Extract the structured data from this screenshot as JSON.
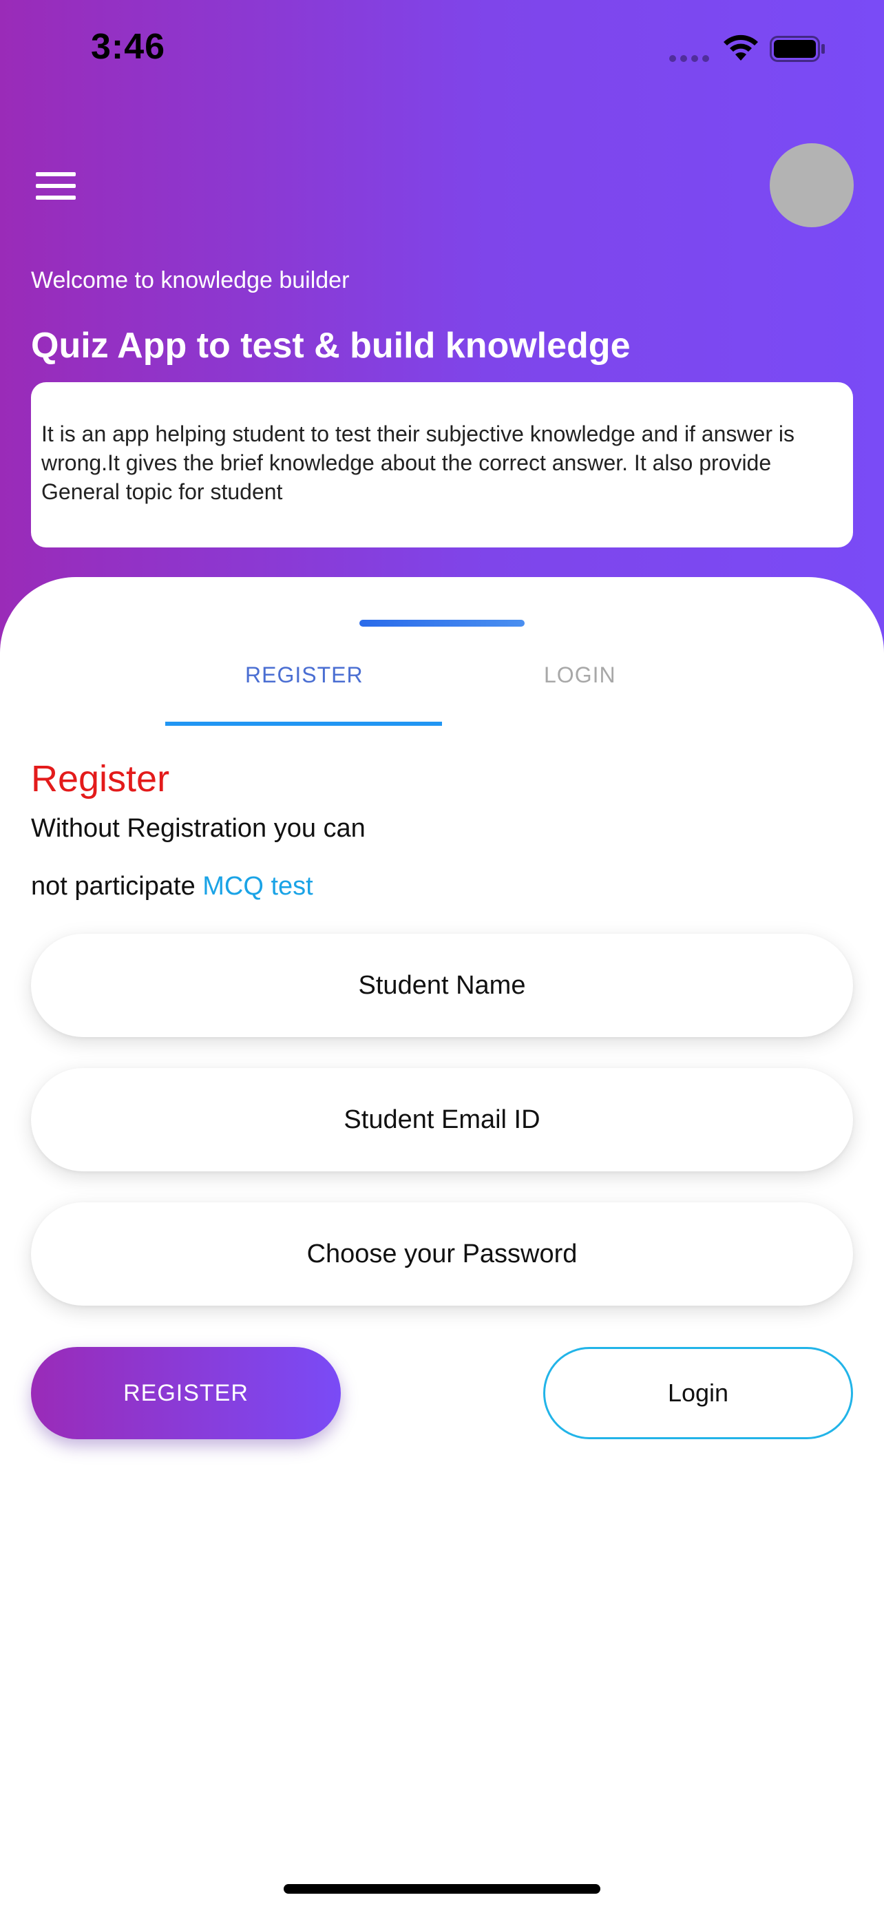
{
  "status_bar": {
    "time": "3:46"
  },
  "header": {
    "welcome": "Welcome to knowledge builder",
    "title": "Quiz App to test & build knowledge",
    "description": "It is an app helping student to test their subjective knowledge and if answer is wrong.It gives the brief knowledge about the correct answer. It also provide General topic for student",
    "gradient_start": "#9a2bb8",
    "gradient_end": "#7a4bf6"
  },
  "tabs": [
    {
      "label": "REGISTER",
      "active": true
    },
    {
      "label": "LOGIN",
      "active": false
    }
  ],
  "register": {
    "heading": "Register",
    "line1": "Without Registration you can",
    "line2_prefix": "not participate",
    "line2_link": "MCQ test"
  },
  "form": {
    "name_placeholder": "Student Name",
    "email_placeholder": "Student Email ID",
    "password_placeholder": "Choose your Password"
  },
  "buttons": {
    "register": "REGISTER",
    "login": "Login"
  },
  "colors": {
    "heading_red": "#e31b1b",
    "link_blue": "#1aa3e6",
    "tab_active": "#4a6ed2",
    "tab_inactive": "#a8a8a8",
    "tab_indicator": "#2196f3",
    "login_border": "#22b4e8",
    "avatar_gray": "#b3b3b3"
  },
  "icons": {
    "menu": "hamburger-menu-icon",
    "avatar": "profile-avatar",
    "wifi": "wifi-icon",
    "battery": "battery-icon",
    "signal": "cellular-signal-icon"
  }
}
